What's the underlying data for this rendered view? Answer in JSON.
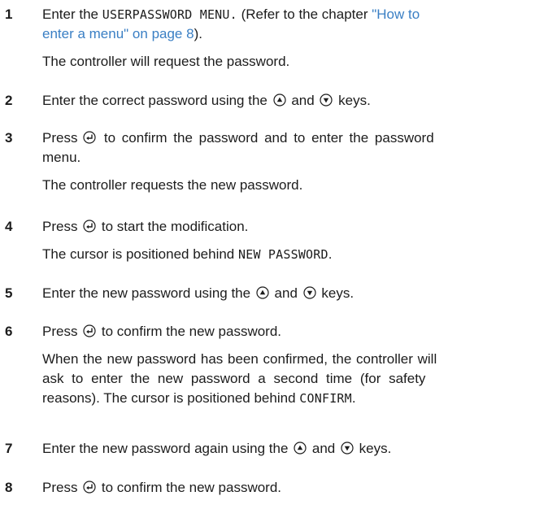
{
  "steps": [
    {
      "number": "1",
      "text_a": "Enter the ",
      "code": "USERPASSWORD MENU.",
      "text_b": " (Refer to the chapter ",
      "link_a": "\"How to",
      "link_b": "enter a menu\" on page 8",
      "text_c": ").",
      "note": "The controller will request the password."
    },
    {
      "number": "2",
      "text_a": "Enter the correct password using the ",
      "text_b": " and ",
      "text_c": " keys."
    },
    {
      "number": "3",
      "text_a": "Press ",
      "text_b": " to confirm the password and to enter the password",
      "text_c": "menu.",
      "note": "The controller requests the new password."
    },
    {
      "number": "4",
      "text_a": "Press ",
      "text_b": " to start the modification.",
      "note_a": "The cursor is positioned behind ",
      "note_code": "NEW PASSWORD",
      "note_b": "."
    },
    {
      "number": "5",
      "text_a": "Enter the new password using the ",
      "text_b": " and ",
      "text_c": " keys."
    },
    {
      "number": "6",
      "text_a": "Press ",
      "text_b": " to confirm the new password.",
      "note_line1": "When the new password has been confirmed, the controller will",
      "note_line2": "ask to enter the new password a second time (for safety",
      "note_line3_a": "reasons). The cursor is positioned behind ",
      "note_code": "CONFIRM",
      "note_line3_b": "."
    },
    {
      "number": "7",
      "text_a": "Enter the new password again using the ",
      "text_b": " and ",
      "text_c": " keys."
    },
    {
      "number": "8",
      "text_a": "Press ",
      "text_b": " to confirm the new password."
    }
  ],
  "icons": {
    "up": "up-arrow-key-icon",
    "down": "down-arrow-key-icon",
    "enter": "enter-key-icon"
  },
  "colors": {
    "text": "#1c1c1c",
    "link": "#3a7fc4"
  }
}
